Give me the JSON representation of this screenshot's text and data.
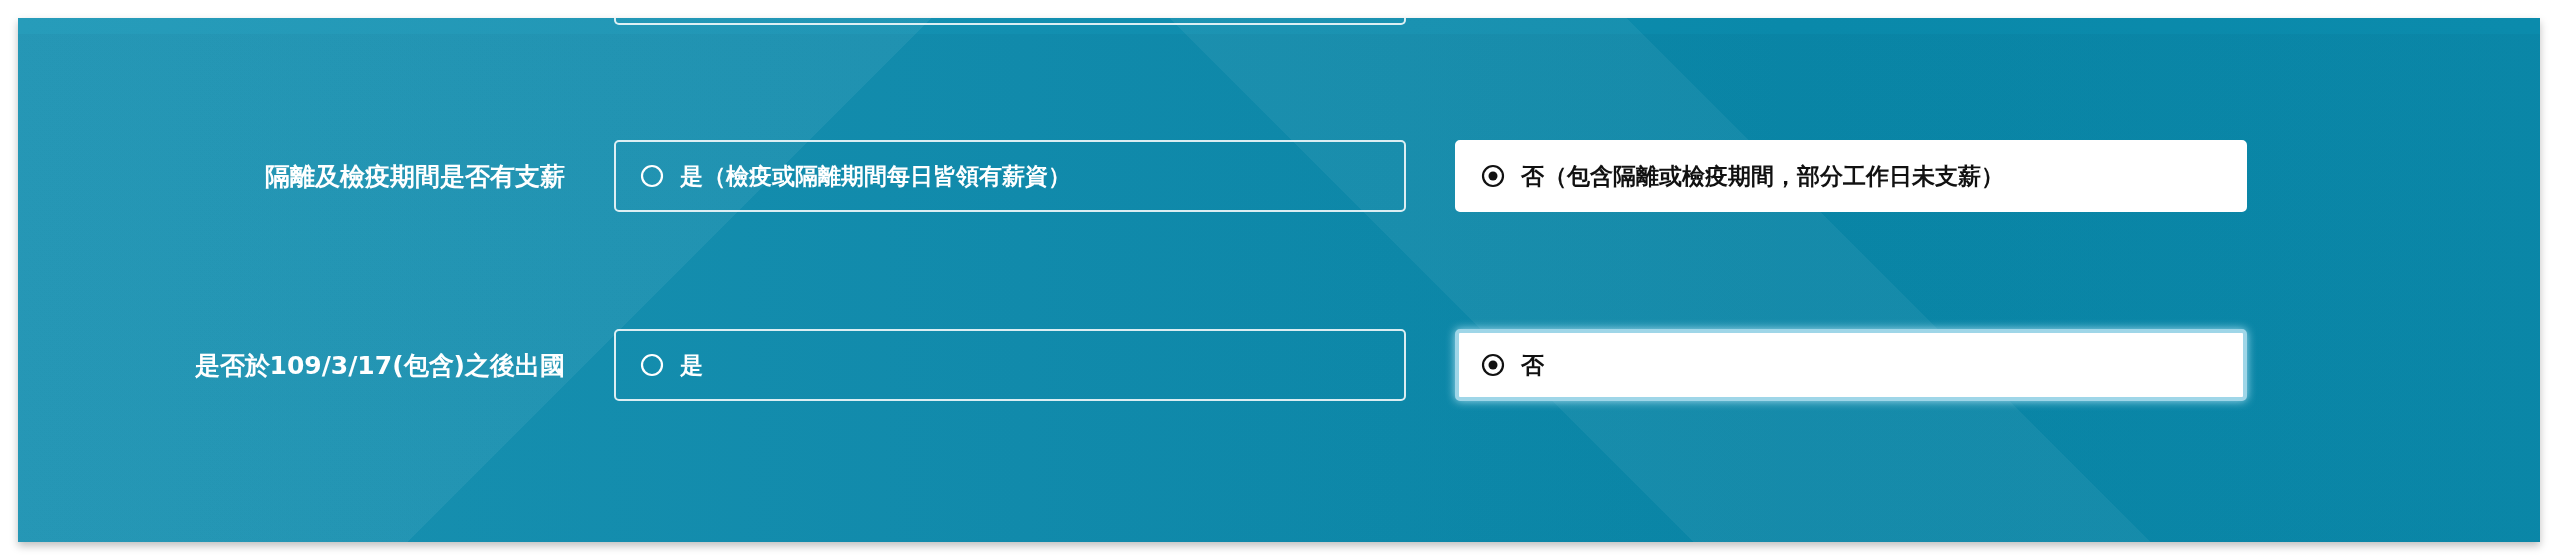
{
  "questions": [
    {
      "label": "隔離及檢疫期間是否有支薪",
      "options": [
        {
          "label": "是（檢疫或隔離期間每日皆領有薪資）",
          "selected": false,
          "focused": false
        },
        {
          "label": "否（包含隔離或檢疫期間，部分工作日未支薪）",
          "selected": true,
          "focused": false
        }
      ]
    },
    {
      "label": "是否於109/3/17(包含)之後出國",
      "options": [
        {
          "label": "是",
          "selected": false,
          "focused": false
        },
        {
          "label": "否",
          "selected": true,
          "focused": true
        }
      ]
    }
  ]
}
